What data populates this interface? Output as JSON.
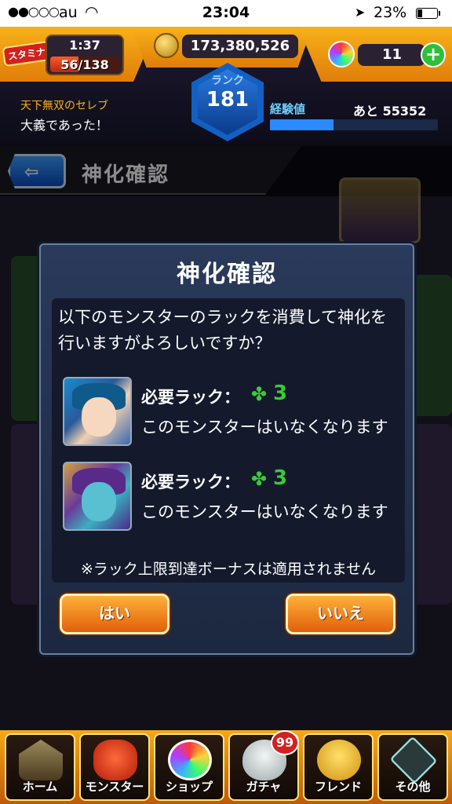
{
  "status_bar": {
    "signal": "●●○○○",
    "carrier": "au",
    "wifi_icon": "wifi-icon",
    "time": "23:04",
    "location_icon": "➤",
    "battery_percent": "23%",
    "battery_level": 0.23
  },
  "hud": {
    "stamina_tag": "スタミナ",
    "stamina_timer": "1:37",
    "stamina": "56/138",
    "stamina_fraction": 0.41,
    "coins": "173,380,526",
    "orbs": "11",
    "orb_plus": "+",
    "rank_label": "ランク",
    "rank": "181",
    "title_sub": "天下無双のセレブ",
    "title_main": "大義であった！",
    "exp_label": "経験値",
    "exp_next": "あと 55352",
    "exp_fraction": 0.38
  },
  "page": {
    "back_arrow": "⇦",
    "title": "神化確認"
  },
  "dialog": {
    "title": "神化確認",
    "message": "以下のモンスターのラックを消費して神化を行いますがよろしいですか？",
    "monsters": [
      {
        "required_label": "必要ラック：",
        "clover": "✤",
        "required_value": "3",
        "note": "このモンスターはいなくなります"
      },
      {
        "required_label": "必要ラック：",
        "clover": "✤",
        "required_value": "3",
        "note": "このモンスターはいなくなります"
      }
    ],
    "bonus_note": "※ラック上限到達ボーナスは適用されません",
    "yes_label": "はい",
    "no_label": "いいえ"
  },
  "bottom_nav": {
    "items": [
      {
        "label": "ホーム",
        "icon": "home-icon"
      },
      {
        "label": "モンスター",
        "icon": "monster-icon"
      },
      {
        "label": "ショップ",
        "icon": "shop-orb-icon"
      },
      {
        "label": "ガチャ",
        "icon": "gacha-egg-icon",
        "badge": "99"
      },
      {
        "label": "フレンド",
        "icon": "friend-icon"
      },
      {
        "label": "その他",
        "icon": "other-icon"
      }
    ]
  }
}
